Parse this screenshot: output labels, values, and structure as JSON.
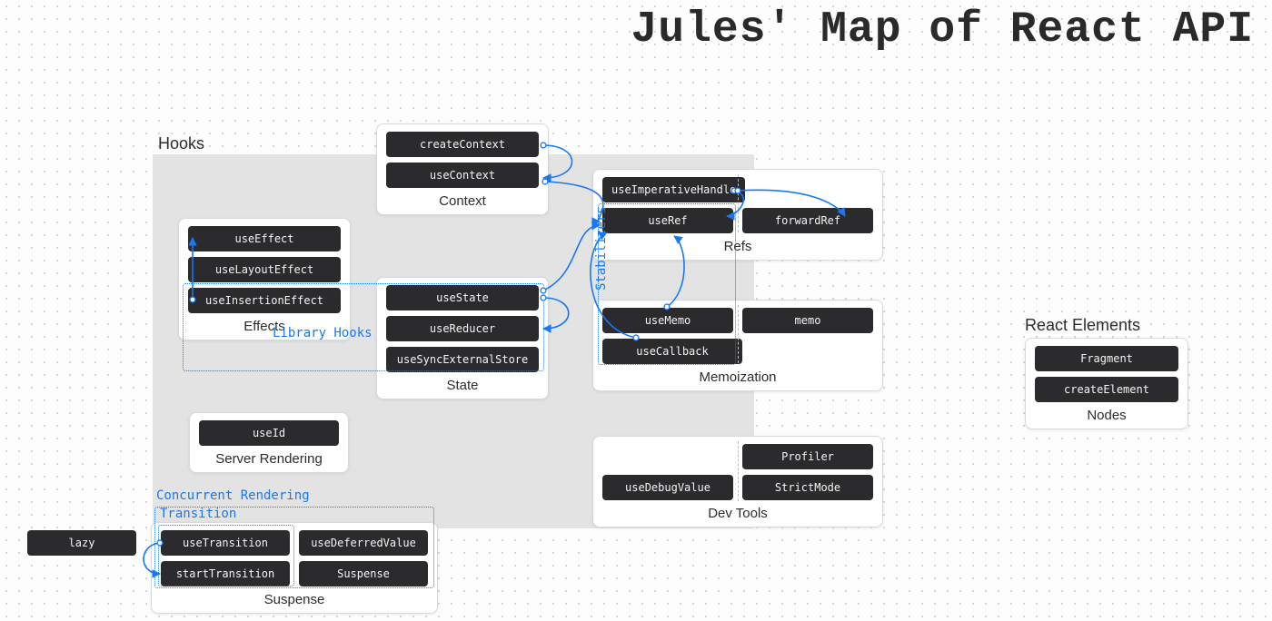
{
  "title": "Jules' Map of React API",
  "sections": {
    "hooks_label": "Hooks",
    "react_elements_label": "React Elements"
  },
  "annotations": {
    "library_hooks": "Library Hooks",
    "stabilizers": "Stabilizers",
    "concurrent_rendering": "Concurrent Rendering",
    "transition": "Transition"
  },
  "groups": {
    "context": {
      "caption": "Context",
      "items": [
        "createContext",
        "useContext"
      ]
    },
    "effects": {
      "caption": "Effects",
      "items": [
        "useEffect",
        "useLayoutEffect",
        "useInsertionEffect"
      ]
    },
    "state": {
      "caption": "State",
      "items": [
        "useState",
        "useReducer",
        "useSyncExternalStore"
      ]
    },
    "refs": {
      "caption": "Refs",
      "items": [
        "useImperativeHandle",
        "useRef",
        "forwardRef"
      ]
    },
    "memoization": {
      "caption": "Memoization",
      "items": [
        "useMemo",
        "useCallback",
        "memo"
      ]
    },
    "server_rendering": {
      "caption": "Server Rendering",
      "items": [
        "useId"
      ]
    },
    "dev_tools": {
      "caption": "Dev Tools",
      "items": [
        "useDebugValue",
        "Profiler",
        "StrictMode"
      ]
    },
    "suspense": {
      "caption": "Suspense",
      "items": [
        "useTransition",
        "useDeferredValue",
        "startTransition",
        "Suspense"
      ]
    },
    "nodes": {
      "caption": "Nodes",
      "items": [
        "Fragment",
        "createElement"
      ]
    }
  },
  "free_pills": {
    "lazy": "lazy"
  },
  "connections": [
    {
      "from": "createContext",
      "to": "useContext",
      "style": "curve"
    },
    {
      "from": "useContext",
      "to": "useRef",
      "style": "curve"
    },
    {
      "from": "useImperativeHandle",
      "to": "useRef",
      "style": "curve"
    },
    {
      "from": "useImperativeHandle",
      "to": "forwardRef",
      "style": "curve"
    },
    {
      "from": "useState",
      "to": "useReducer",
      "style": "curve"
    },
    {
      "from": "useState",
      "to": "useRef",
      "style": "curve"
    },
    {
      "from": "useMemo",
      "to": "useRef",
      "style": "curve"
    },
    {
      "from": "useCallback",
      "to": "useRef",
      "style": "curve"
    },
    {
      "from": "useTransition",
      "to": "startTransition",
      "style": "curve"
    },
    {
      "from": "useEffect",
      "to": "useInsertionEffect",
      "style": "straight"
    }
  ]
}
